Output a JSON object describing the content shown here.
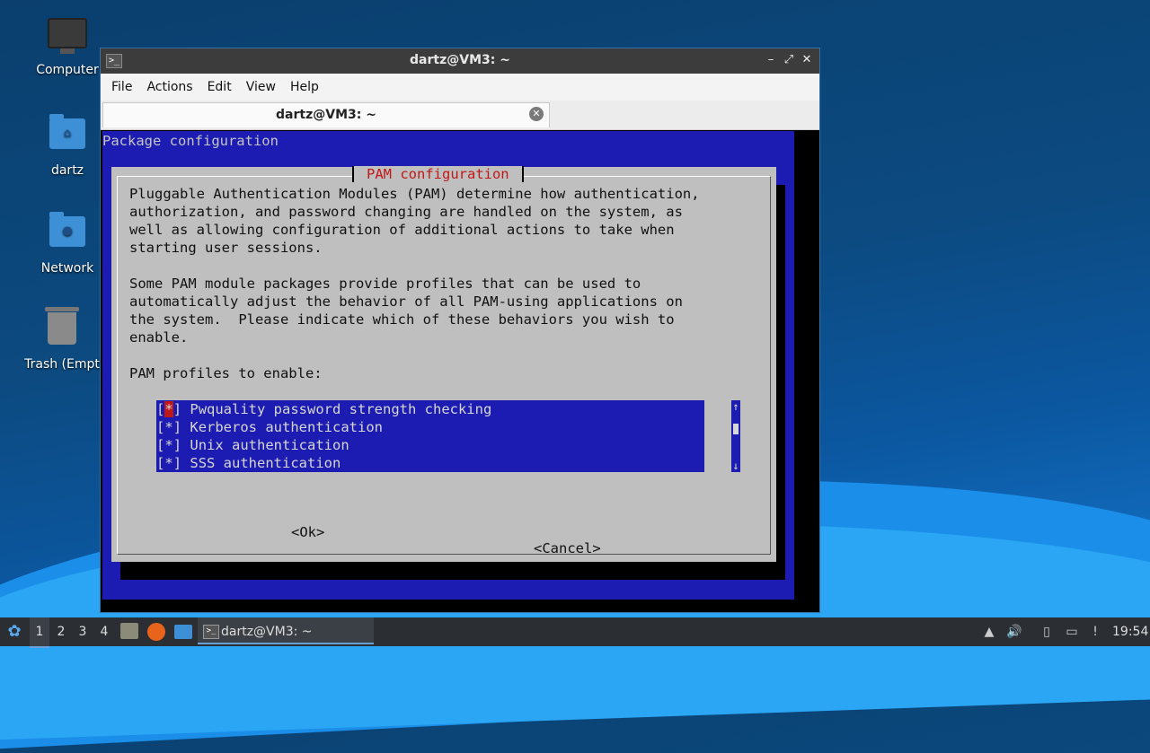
{
  "desktop": {
    "icons": [
      {
        "label": "Computer"
      },
      {
        "label": "dartz"
      },
      {
        "label": "Network"
      },
      {
        "label": "Trash (Empt"
      }
    ]
  },
  "window": {
    "title": "dartz@VM3: ~",
    "app_icon": ">_",
    "controls": {
      "minimize": "–",
      "maximize": "⤢",
      "close": "✕"
    },
    "menu": [
      "File",
      "Actions",
      "Edit",
      "View",
      "Help"
    ],
    "tab": {
      "label": "dartz@VM3: ~",
      "close": "✕"
    }
  },
  "terminal": {
    "header": "Package configuration",
    "dialog": {
      "title": "PAM configuration",
      "text": "Pluggable Authentication Modules (PAM) determine how authentication,\nauthorization, and password changing are handled on the system, as\nwell as allowing configuration of additional actions to take when\nstarting user sessions.\n\nSome PAM module packages provide profiles that can be used to\nautomatically adjust the behavior of all PAM-using applications on\nthe system.  Please indicate which of these behaviors you wish to\nenable.\n\nPAM profiles to enable:",
      "items": [
        {
          "mark": "*",
          "label": "Pwquality password strength checking",
          "focused": true
        },
        {
          "mark": "*",
          "label": "Kerberos authentication",
          "focused": false
        },
        {
          "mark": "*",
          "label": "Unix authentication",
          "focused": false
        },
        {
          "mark": "*",
          "label": "SSS authentication",
          "focused": false
        }
      ],
      "scroll_up": "↑",
      "scroll_down": "↓",
      "ok": "<Ok>",
      "cancel": "<Cancel>"
    }
  },
  "taskbar": {
    "workspaces": [
      "1",
      "2",
      "3",
      "4"
    ],
    "active_workspace": "1",
    "task_label": "dartz@VM3: ~",
    "clock": "19:54"
  }
}
